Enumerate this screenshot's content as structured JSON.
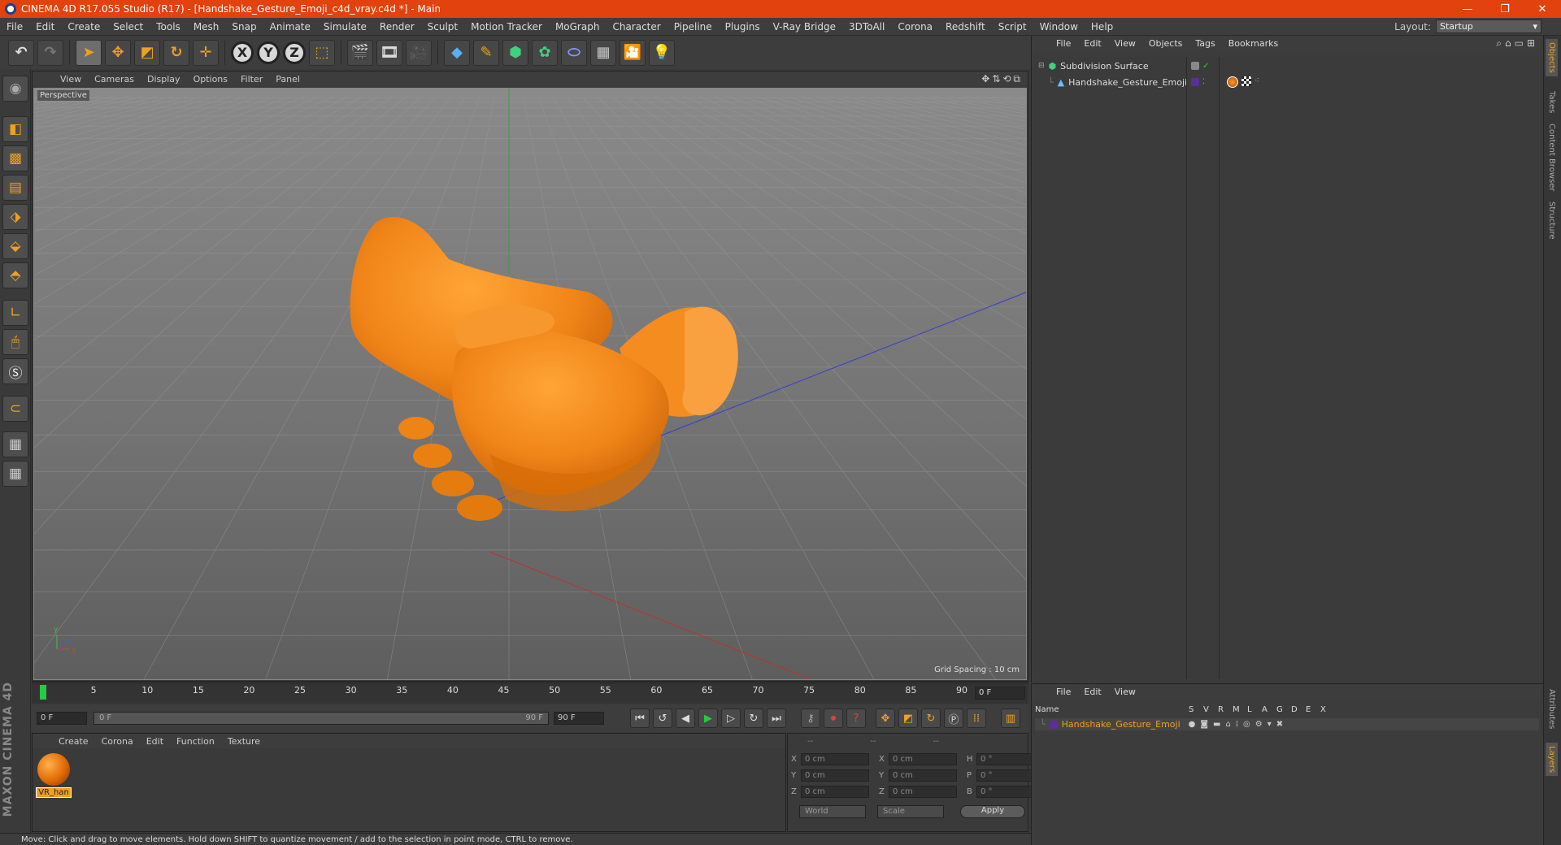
{
  "window": {
    "title": "CINEMA 4D R17.055 Studio (R17) - [Handshake_Gesture_Emoji_c4d_vray.c4d *] - Main",
    "minimize": "—",
    "restore": "❐",
    "close": "✕"
  },
  "menu": [
    "File",
    "Edit",
    "Create",
    "Select",
    "Tools",
    "Mesh",
    "Snap",
    "Animate",
    "Simulate",
    "Render",
    "Sculpt",
    "Motion Tracker",
    "MoGraph",
    "Character",
    "Pipeline",
    "Plugins",
    "V-Ray Bridge",
    "3DToAll",
    "Corona",
    "Redshift",
    "Script",
    "Window",
    "Help"
  ],
  "layout": {
    "label": "Layout:",
    "value": "Startup"
  },
  "viewport": {
    "menu": [
      "View",
      "Cameras",
      "Display",
      "Options",
      "Filter",
      "Panel"
    ],
    "label": "Perspective",
    "grid_spacing": "Grid Spacing : 10 cm",
    "axes": {
      "y": "y",
      "x": "x",
      "z": "z"
    }
  },
  "timeline": {
    "ticks": [
      "0",
      "5",
      "10",
      "15",
      "20",
      "25",
      "30",
      "35",
      "40",
      "45",
      "50",
      "55",
      "60",
      "65",
      "70",
      "75",
      "80",
      "85",
      "90"
    ],
    "current_frame": "0 F"
  },
  "transport": {
    "start": "0 F",
    "slider_start": "0 F",
    "slider_end": "90 F",
    "end": "90 F"
  },
  "materials": {
    "menu": [
      "Create",
      "Corona",
      "Edit",
      "Function",
      "Texture"
    ],
    "items": [
      {
        "name": "VR_han"
      }
    ]
  },
  "coordinates": {
    "headers": [
      "--",
      "--",
      "--"
    ],
    "rows": [
      {
        "a1": "X",
        "v1": "0 cm",
        "a2": "X",
        "v2": "0 cm",
        "a3": "H",
        "v3": "0 °"
      },
      {
        "a1": "Y",
        "v1": "0 cm",
        "a2": "Y",
        "v2": "0 cm",
        "a3": "P",
        "v3": "0 °"
      },
      {
        "a1": "Z",
        "v1": "0 cm",
        "a2": "Z",
        "v2": "0 cm",
        "a3": "B",
        "v3": "0 °"
      }
    ],
    "space": "World",
    "mode": "Scale",
    "apply": "Apply"
  },
  "status": "Move: Click and drag to move elements. Hold down SHIFT to quantize movement / add to the selection in point mode, CTRL to remove.",
  "objects": {
    "menu": [
      "File",
      "Edit",
      "View",
      "Objects",
      "Tags",
      "Bookmarks"
    ],
    "items": [
      {
        "name": "Subdivision Surface"
      },
      {
        "name": "Handshake_Gesture_Emoji"
      }
    ]
  },
  "layers": {
    "menu": [
      "File",
      "Edit",
      "View"
    ],
    "columns": [
      "Name",
      "S",
      "V",
      "R",
      "M",
      "L",
      "A",
      "G",
      "D",
      "E",
      "X"
    ],
    "items": [
      {
        "name": "Handshake_Gesture_Emoji"
      }
    ]
  },
  "right_tabs": [
    "Objects",
    "Takes",
    "Content Browser",
    "Structure",
    "Attributes",
    "Layers"
  ],
  "brand": "MAXON CINEMA 4D",
  "colors": {
    "accent": "#f0a020",
    "title_bar": "#e1420e",
    "model": "#f28a1e"
  }
}
